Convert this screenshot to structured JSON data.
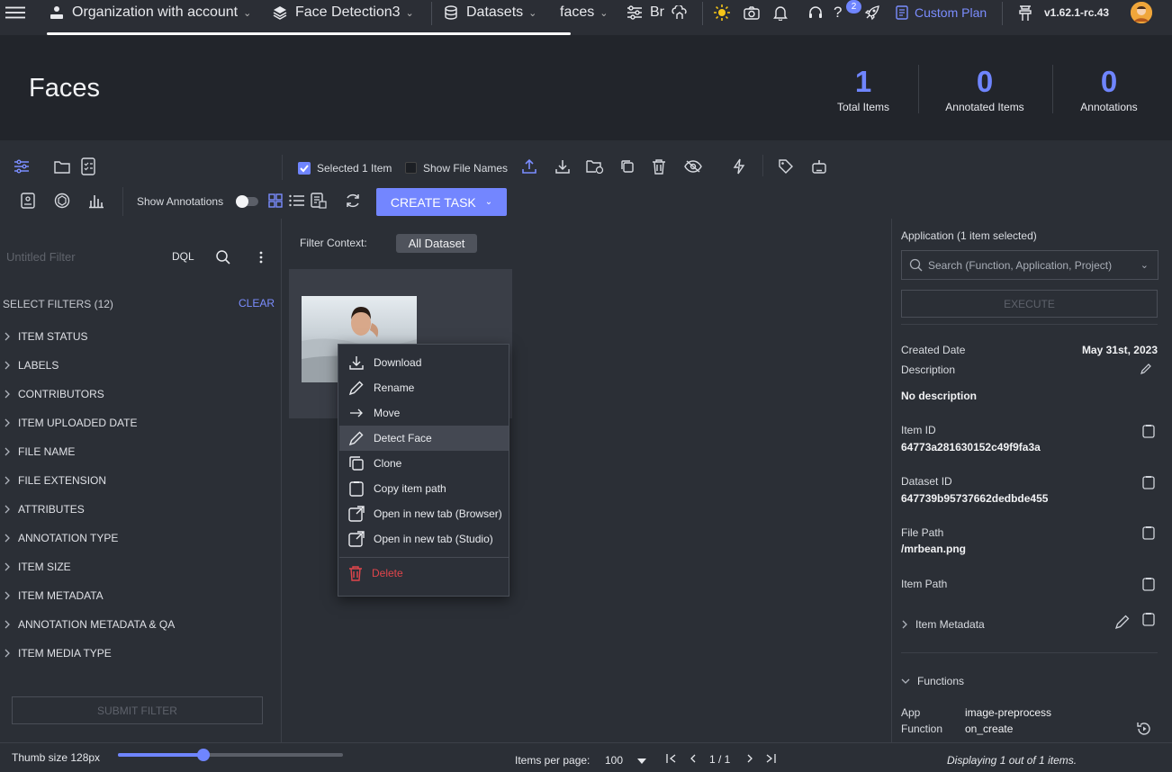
{
  "topbar": {
    "org": "Organization with account",
    "project": "Face Detection3",
    "section": "Datasets",
    "dataset": "faces",
    "branch": "Br",
    "notifications_badge": "2",
    "plan": "Custom Plan",
    "version": "v1.62.1-rc.43"
  },
  "header": {
    "title": "Faces",
    "stats": [
      {
        "value": "1",
        "label": "Total Items"
      },
      {
        "value": "0",
        "label": "Annotated Items"
      },
      {
        "value": "0",
        "label": "Annotations"
      }
    ]
  },
  "toolbar": {
    "selected_label": "Selected 1 Item",
    "selected_checked": true,
    "show_file_names": "Show File Names",
    "show_annotations": "Show Annotations",
    "create_task": "CREATE TASK"
  },
  "filters": {
    "placeholder": "Untitled Filter",
    "dql": "DQL",
    "select_filters": "SELECT FILTERS (12)",
    "clear": "CLEAR",
    "items": [
      "ITEM STATUS",
      "LABELS",
      "CONTRIBUTORS",
      "ITEM UPLOADED DATE",
      "FILE NAME",
      "FILE EXTENSION",
      "ATTRIBUTES",
      "ANNOTATION TYPE",
      "ITEM SIZE",
      "ITEM METADATA",
      "ANNOTATION METADATA & QA",
      "ITEM MEDIA TYPE"
    ],
    "submit": "SUBMIT FILTER"
  },
  "content": {
    "filter_context_label": "Filter Context:",
    "filter_context_value": "All Dataset"
  },
  "context_menu": {
    "items": [
      {
        "label": "Download",
        "icon": "download-icon"
      },
      {
        "label": "Rename",
        "icon": "pencil-icon"
      },
      {
        "label": "Move",
        "icon": "arrow-right-icon"
      },
      {
        "label": "Detect Face",
        "icon": "pencil-icon"
      },
      {
        "label": "Clone",
        "icon": "clone-icon"
      },
      {
        "label": "Copy item path",
        "icon": "clipboard-icon"
      },
      {
        "label": "Open in new tab (Browser)",
        "icon": "external-link-icon"
      },
      {
        "label": "Open in new tab (Studio)",
        "icon": "external-link-icon"
      },
      {
        "label": "Delete",
        "icon": "trash-icon"
      }
    ],
    "highlighted_index": 3,
    "danger_color": "#e0454b"
  },
  "right_panel": {
    "application_label": "Application (1 item selected)",
    "search_placeholder": "Search (Function, Application, Project)",
    "execute": "EXECUTE",
    "created_date_label": "Created Date",
    "created_date": "May 31st, 2023",
    "description_label": "Description",
    "description_value": "No description",
    "item_id_label": "Item ID",
    "item_id": "64773a281630152c49f9fa3a",
    "dataset_id_label": "Dataset ID",
    "dataset_id": "647739b95737662dedbde455",
    "file_path_label": "File Path",
    "file_path": "/mrbean.png",
    "item_path_label": "Item Path",
    "item_metadata": "Item Metadata",
    "functions": "Functions",
    "app_label": "App",
    "app_value": "image-preprocess",
    "function_label": "Function",
    "function_value": "on_create"
  },
  "footer": {
    "thumb_size": "Thumb size 128px",
    "thumb_slider_fraction": 0.38,
    "items_per_page_label": "Items per page:",
    "items_per_page": "100",
    "page": "1 / 1",
    "displaying": "Displaying 1 out of 1 items."
  },
  "colors": {
    "accent": "#6f85ff",
    "create_task_bg": "#7386ff"
  }
}
